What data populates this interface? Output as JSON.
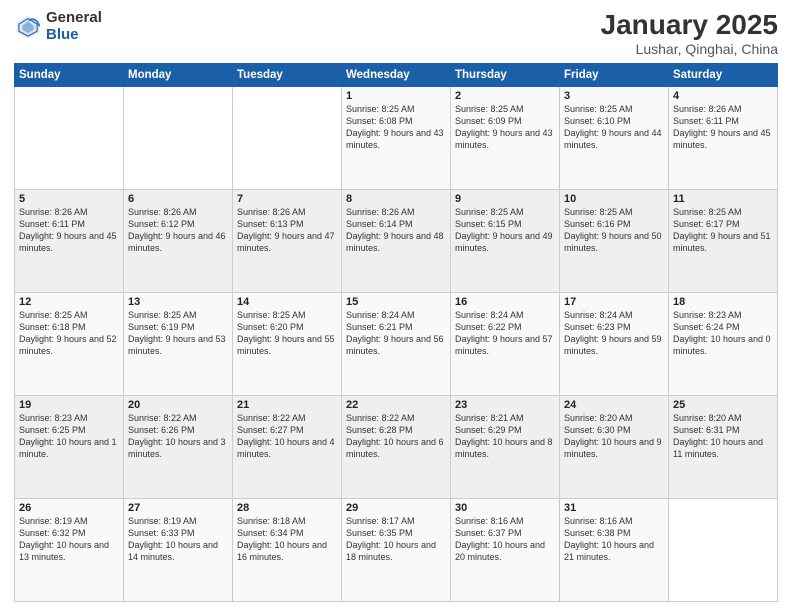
{
  "logo": {
    "general": "General",
    "blue": "Blue"
  },
  "header": {
    "title": "January 2025",
    "subtitle": "Lushar, Qinghai, China"
  },
  "weekdays": [
    "Sunday",
    "Monday",
    "Tuesday",
    "Wednesday",
    "Thursday",
    "Friday",
    "Saturday"
  ],
  "weeks": [
    [
      {
        "day": "",
        "info": ""
      },
      {
        "day": "",
        "info": ""
      },
      {
        "day": "",
        "info": ""
      },
      {
        "day": "1",
        "info": "Sunrise: 8:25 AM\nSunset: 6:08 PM\nDaylight: 9 hours and 43 minutes."
      },
      {
        "day": "2",
        "info": "Sunrise: 8:25 AM\nSunset: 6:09 PM\nDaylight: 9 hours and 43 minutes."
      },
      {
        "day": "3",
        "info": "Sunrise: 8:25 AM\nSunset: 6:10 PM\nDaylight: 9 hours and 44 minutes."
      },
      {
        "day": "4",
        "info": "Sunrise: 8:26 AM\nSunset: 6:11 PM\nDaylight: 9 hours and 45 minutes."
      }
    ],
    [
      {
        "day": "5",
        "info": "Sunrise: 8:26 AM\nSunset: 6:11 PM\nDaylight: 9 hours and 45 minutes."
      },
      {
        "day": "6",
        "info": "Sunrise: 8:26 AM\nSunset: 6:12 PM\nDaylight: 9 hours and 46 minutes."
      },
      {
        "day": "7",
        "info": "Sunrise: 8:26 AM\nSunset: 6:13 PM\nDaylight: 9 hours and 47 minutes."
      },
      {
        "day": "8",
        "info": "Sunrise: 8:26 AM\nSunset: 6:14 PM\nDaylight: 9 hours and 48 minutes."
      },
      {
        "day": "9",
        "info": "Sunrise: 8:25 AM\nSunset: 6:15 PM\nDaylight: 9 hours and 49 minutes."
      },
      {
        "day": "10",
        "info": "Sunrise: 8:25 AM\nSunset: 6:16 PM\nDaylight: 9 hours and 50 minutes."
      },
      {
        "day": "11",
        "info": "Sunrise: 8:25 AM\nSunset: 6:17 PM\nDaylight: 9 hours and 51 minutes."
      }
    ],
    [
      {
        "day": "12",
        "info": "Sunrise: 8:25 AM\nSunset: 6:18 PM\nDaylight: 9 hours and 52 minutes."
      },
      {
        "day": "13",
        "info": "Sunrise: 8:25 AM\nSunset: 6:19 PM\nDaylight: 9 hours and 53 minutes."
      },
      {
        "day": "14",
        "info": "Sunrise: 8:25 AM\nSunset: 6:20 PM\nDaylight: 9 hours and 55 minutes."
      },
      {
        "day": "15",
        "info": "Sunrise: 8:24 AM\nSunset: 6:21 PM\nDaylight: 9 hours and 56 minutes."
      },
      {
        "day": "16",
        "info": "Sunrise: 8:24 AM\nSunset: 6:22 PM\nDaylight: 9 hours and 57 minutes."
      },
      {
        "day": "17",
        "info": "Sunrise: 8:24 AM\nSunset: 6:23 PM\nDaylight: 9 hours and 59 minutes."
      },
      {
        "day": "18",
        "info": "Sunrise: 8:23 AM\nSunset: 6:24 PM\nDaylight: 10 hours and 0 minutes."
      }
    ],
    [
      {
        "day": "19",
        "info": "Sunrise: 8:23 AM\nSunset: 6:25 PM\nDaylight: 10 hours and 1 minute."
      },
      {
        "day": "20",
        "info": "Sunrise: 8:22 AM\nSunset: 6:26 PM\nDaylight: 10 hours and 3 minutes."
      },
      {
        "day": "21",
        "info": "Sunrise: 8:22 AM\nSunset: 6:27 PM\nDaylight: 10 hours and 4 minutes."
      },
      {
        "day": "22",
        "info": "Sunrise: 8:22 AM\nSunset: 6:28 PM\nDaylight: 10 hours and 6 minutes."
      },
      {
        "day": "23",
        "info": "Sunrise: 8:21 AM\nSunset: 6:29 PM\nDaylight: 10 hours and 8 minutes."
      },
      {
        "day": "24",
        "info": "Sunrise: 8:20 AM\nSunset: 6:30 PM\nDaylight: 10 hours and 9 minutes."
      },
      {
        "day": "25",
        "info": "Sunrise: 8:20 AM\nSunset: 6:31 PM\nDaylight: 10 hours and 11 minutes."
      }
    ],
    [
      {
        "day": "26",
        "info": "Sunrise: 8:19 AM\nSunset: 6:32 PM\nDaylight: 10 hours and 13 minutes."
      },
      {
        "day": "27",
        "info": "Sunrise: 8:19 AM\nSunset: 6:33 PM\nDaylight: 10 hours and 14 minutes."
      },
      {
        "day": "28",
        "info": "Sunrise: 8:18 AM\nSunset: 6:34 PM\nDaylight: 10 hours and 16 minutes."
      },
      {
        "day": "29",
        "info": "Sunrise: 8:17 AM\nSunset: 6:35 PM\nDaylight: 10 hours and 18 minutes."
      },
      {
        "day": "30",
        "info": "Sunrise: 8:16 AM\nSunset: 6:37 PM\nDaylight: 10 hours and 20 minutes."
      },
      {
        "day": "31",
        "info": "Sunrise: 8:16 AM\nSunset: 6:38 PM\nDaylight: 10 hours and 21 minutes."
      },
      {
        "day": "",
        "info": ""
      }
    ]
  ]
}
